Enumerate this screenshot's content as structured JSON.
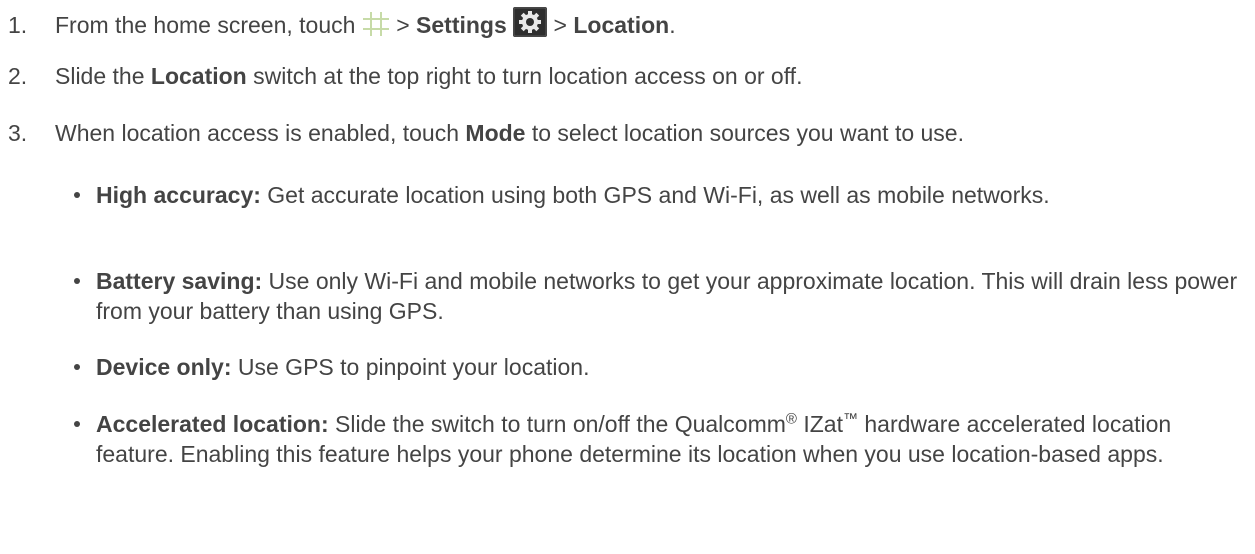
{
  "steps": [
    {
      "num": "1.",
      "t1": "From the home screen, touch ",
      "t2": " > ",
      "b1": "Settings",
      "t3": " > ",
      "b2": "Location",
      "t4": "."
    },
    {
      "num": "2.",
      "t1": "Slide the ",
      "b1": "Location",
      "t2": " switch at the top right to turn location access on or off."
    },
    {
      "num": "3.",
      "t1": "When location access is enabled, touch ",
      "b1": "Mode",
      "t2": " to select location sources you want to use."
    }
  ],
  "bullets": [
    {
      "label": "High accuracy:",
      "text": " Get accurate location using both GPS and Wi-Fi, as well as mobile networks."
    },
    {
      "label": "Battery saving:",
      "text": " Use only Wi-Fi and mobile networks to get your approximate location. This will drain less power from your battery than using GPS."
    },
    {
      "label": "Device only:",
      "text": " Use GPS to pinpoint your location."
    },
    {
      "label": "Accelerated location:",
      "t1": " Slide the switch to turn on/off the Qualcomm",
      "sup1": "®",
      "t2": " IZat",
      "sup2": "™",
      "t3": " hardware accelerated location feature. Enabling this feature helps your phone determine its location when you use location-based apps."
    }
  ],
  "icons": {
    "apps": "apps-grid-icon",
    "settings": "settings-gear-icon"
  }
}
